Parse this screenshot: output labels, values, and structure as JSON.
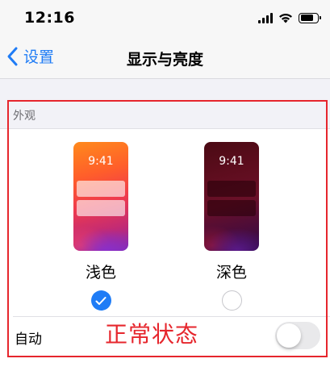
{
  "status_bar": {
    "time": "12:16",
    "icons": [
      "cellular-signal-icon",
      "wifi-icon",
      "battery-icon"
    ]
  },
  "nav": {
    "back_label": "设置",
    "title": "显示与亮度"
  },
  "appearance": {
    "section_header": "外观",
    "options": [
      {
        "label": "浅色",
        "preview_time": "9:41",
        "selected": true
      },
      {
        "label": "深色",
        "preview_time": "9:41",
        "selected": false
      }
    ],
    "automatic": {
      "label": "自动",
      "enabled": false
    }
  },
  "annotation": {
    "text": "正常状态"
  },
  "colors": {
    "accent": "#1f7cf6",
    "annotation_red": "#e6262d",
    "background": "#f2f2f7"
  }
}
